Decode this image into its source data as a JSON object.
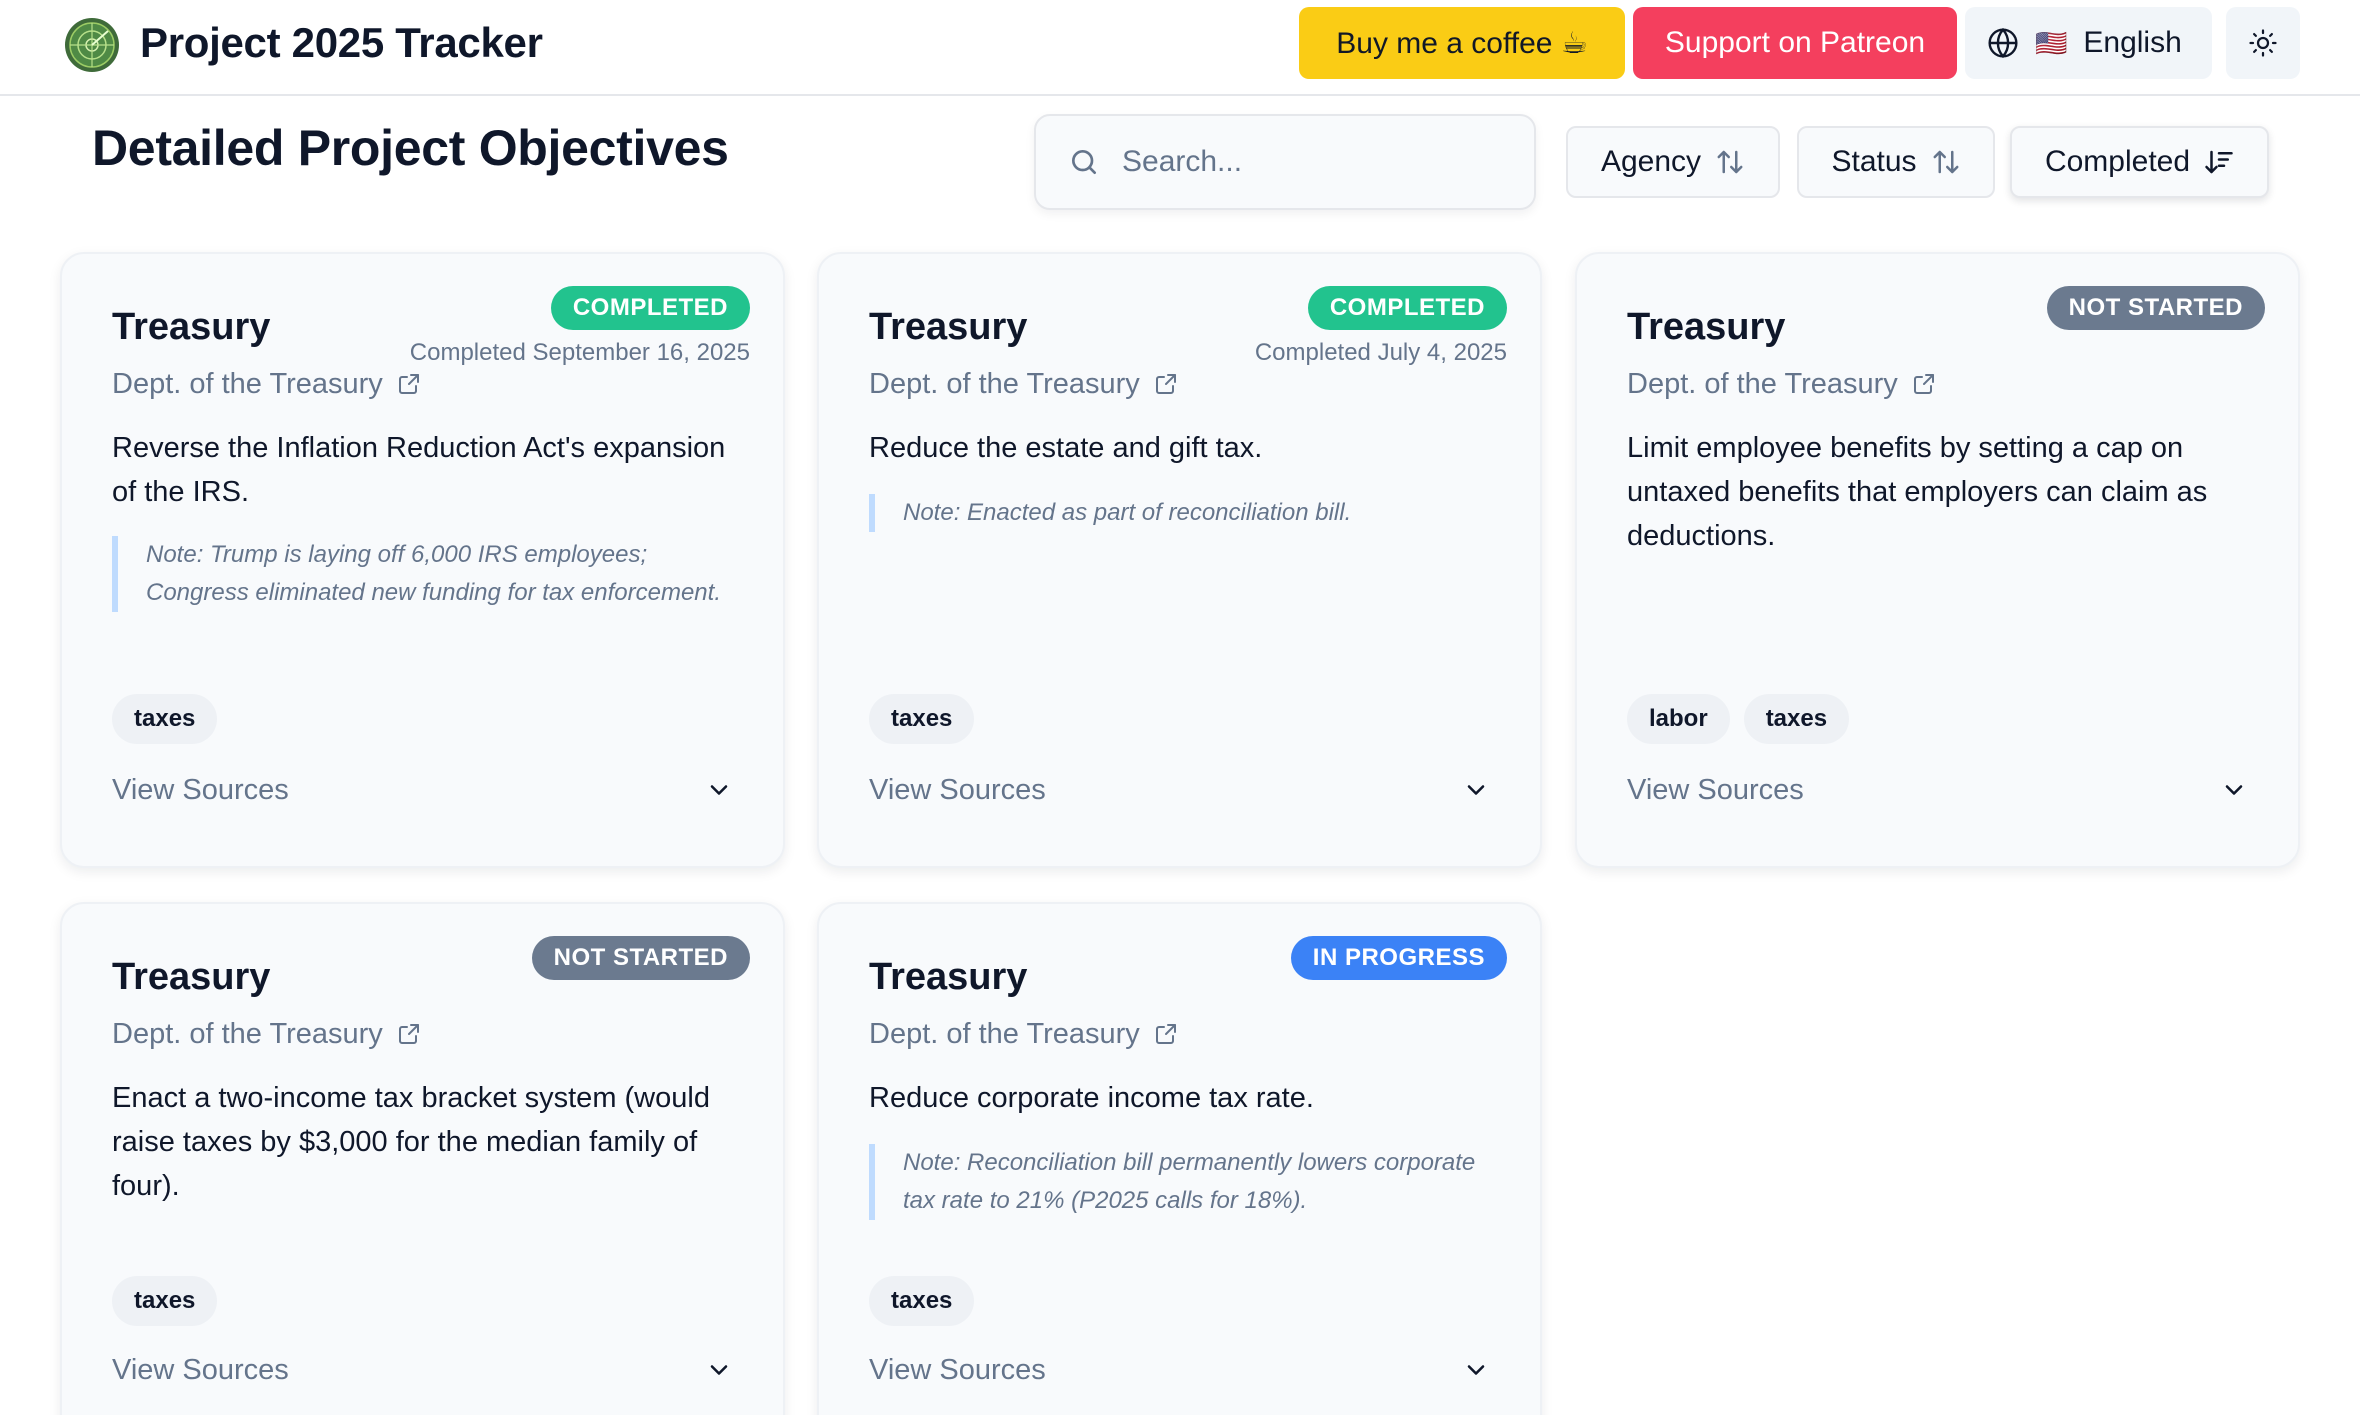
{
  "header": {
    "app_title": "Project 2025 Tracker",
    "coffee_label": "Buy me a coffee ☕",
    "patreon_label": "Support on Patreon",
    "language_flag": "🇺🇸",
    "language_label": "English",
    "icons": [
      "globe-icon",
      "sun-icon"
    ]
  },
  "toolbar": {
    "page_title": "Detailed Project Objectives",
    "search_placeholder": "Search...",
    "sort_buttons": [
      {
        "label": "Agency",
        "icon": "sort-arrows-icon"
      },
      {
        "label": "Status",
        "icon": "sort-arrows-icon"
      },
      {
        "label": "Completed",
        "icon": "sort-descending-icon"
      }
    ]
  },
  "colors": {
    "completed": "#22c38e",
    "not_started": "#6b7a8f",
    "in_progress": "#3b82f6",
    "coffee": "#facc15",
    "patreon": "#f43f5e"
  },
  "cards": [
    {
      "agency": "Treasury",
      "dept": "Dept. of the Treasury",
      "status": "COMPLETED",
      "completed_date": "Completed September 16, 2025",
      "objective": "Reverse the Inflation Reduction Act's expansion of the IRS.",
      "note": "Note: Trump is laying off 6,000 IRS employees; Congress eliminated new funding for tax enforcement.",
      "tags": [
        "taxes"
      ],
      "sources_label": "View Sources"
    },
    {
      "agency": "Treasury",
      "dept": "Dept. of the Treasury",
      "status": "COMPLETED",
      "completed_date": "Completed July 4, 2025",
      "objective": "Reduce the estate and gift tax.",
      "note": "Note: Enacted as part of reconciliation bill.",
      "tags": [
        "taxes"
      ],
      "sources_label": "View Sources"
    },
    {
      "agency": "Treasury",
      "dept": "Dept. of the Treasury",
      "status": "NOT STARTED",
      "objective": "Limit employee benefits by setting a cap on untaxed benefits that employers can claim as deductions.",
      "tags": [
        "labor",
        "taxes"
      ],
      "sources_label": "View Sources"
    },
    {
      "agency": "Treasury",
      "dept": "Dept. of the Treasury",
      "status": "NOT STARTED",
      "objective": "Enact a two-income tax bracket system (would raise taxes by $3,000 for the median family of four).",
      "tags": [
        "taxes"
      ],
      "sources_label": "View Sources"
    },
    {
      "agency": "Treasury",
      "dept": "Dept. of the Treasury",
      "status": "IN PROGRESS",
      "objective": "Reduce corporate income tax rate.",
      "note": "Note: Reconciliation bill permanently lowers corporate tax rate to 21% (P2025 calls for 18%).",
      "tags": [
        "taxes"
      ],
      "sources_label": "View Sources"
    }
  ]
}
